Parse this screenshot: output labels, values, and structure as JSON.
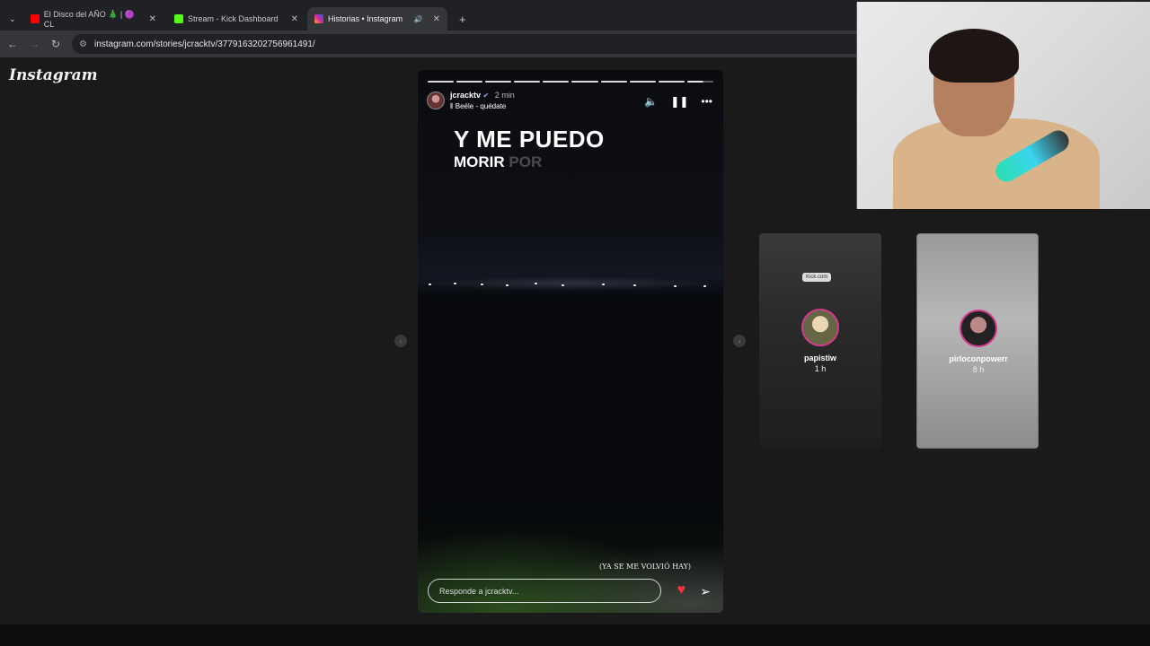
{
  "browser": {
    "tabs": [
      {
        "label": "El Disco del AÑO 🎄 | 🟣 CL",
        "active": false
      },
      {
        "label": "Stream - Kick Dashboard",
        "active": false
      },
      {
        "label": "Historias • Instagram",
        "active": true
      }
    ],
    "new_tab": "+",
    "url": "instagram.com/stories/jcracktv/3779163202756961491/"
  },
  "instagram": {
    "logo": "Instagram",
    "story": {
      "username": "jcracktv",
      "time": "2 min",
      "music": "Beéle - quédate",
      "lyric_line1": "Y ME PUEDO",
      "lyric_line2": "MORIR",
      "lyric_faded": "POR",
      "caption": "(YA SE ME VOLVIÓ HAY)",
      "reply_placeholder": "Responde a jcracktv...",
      "segments": 10
    },
    "next_stories": [
      {
        "username": "papistiw",
        "time": "1 h",
        "chip": "Kick.com"
      },
      {
        "username": "pirloconpowerr",
        "time": "8 h"
      }
    ]
  },
  "colors": {
    "like": "#ff3040",
    "ring": "#d43a8c"
  }
}
